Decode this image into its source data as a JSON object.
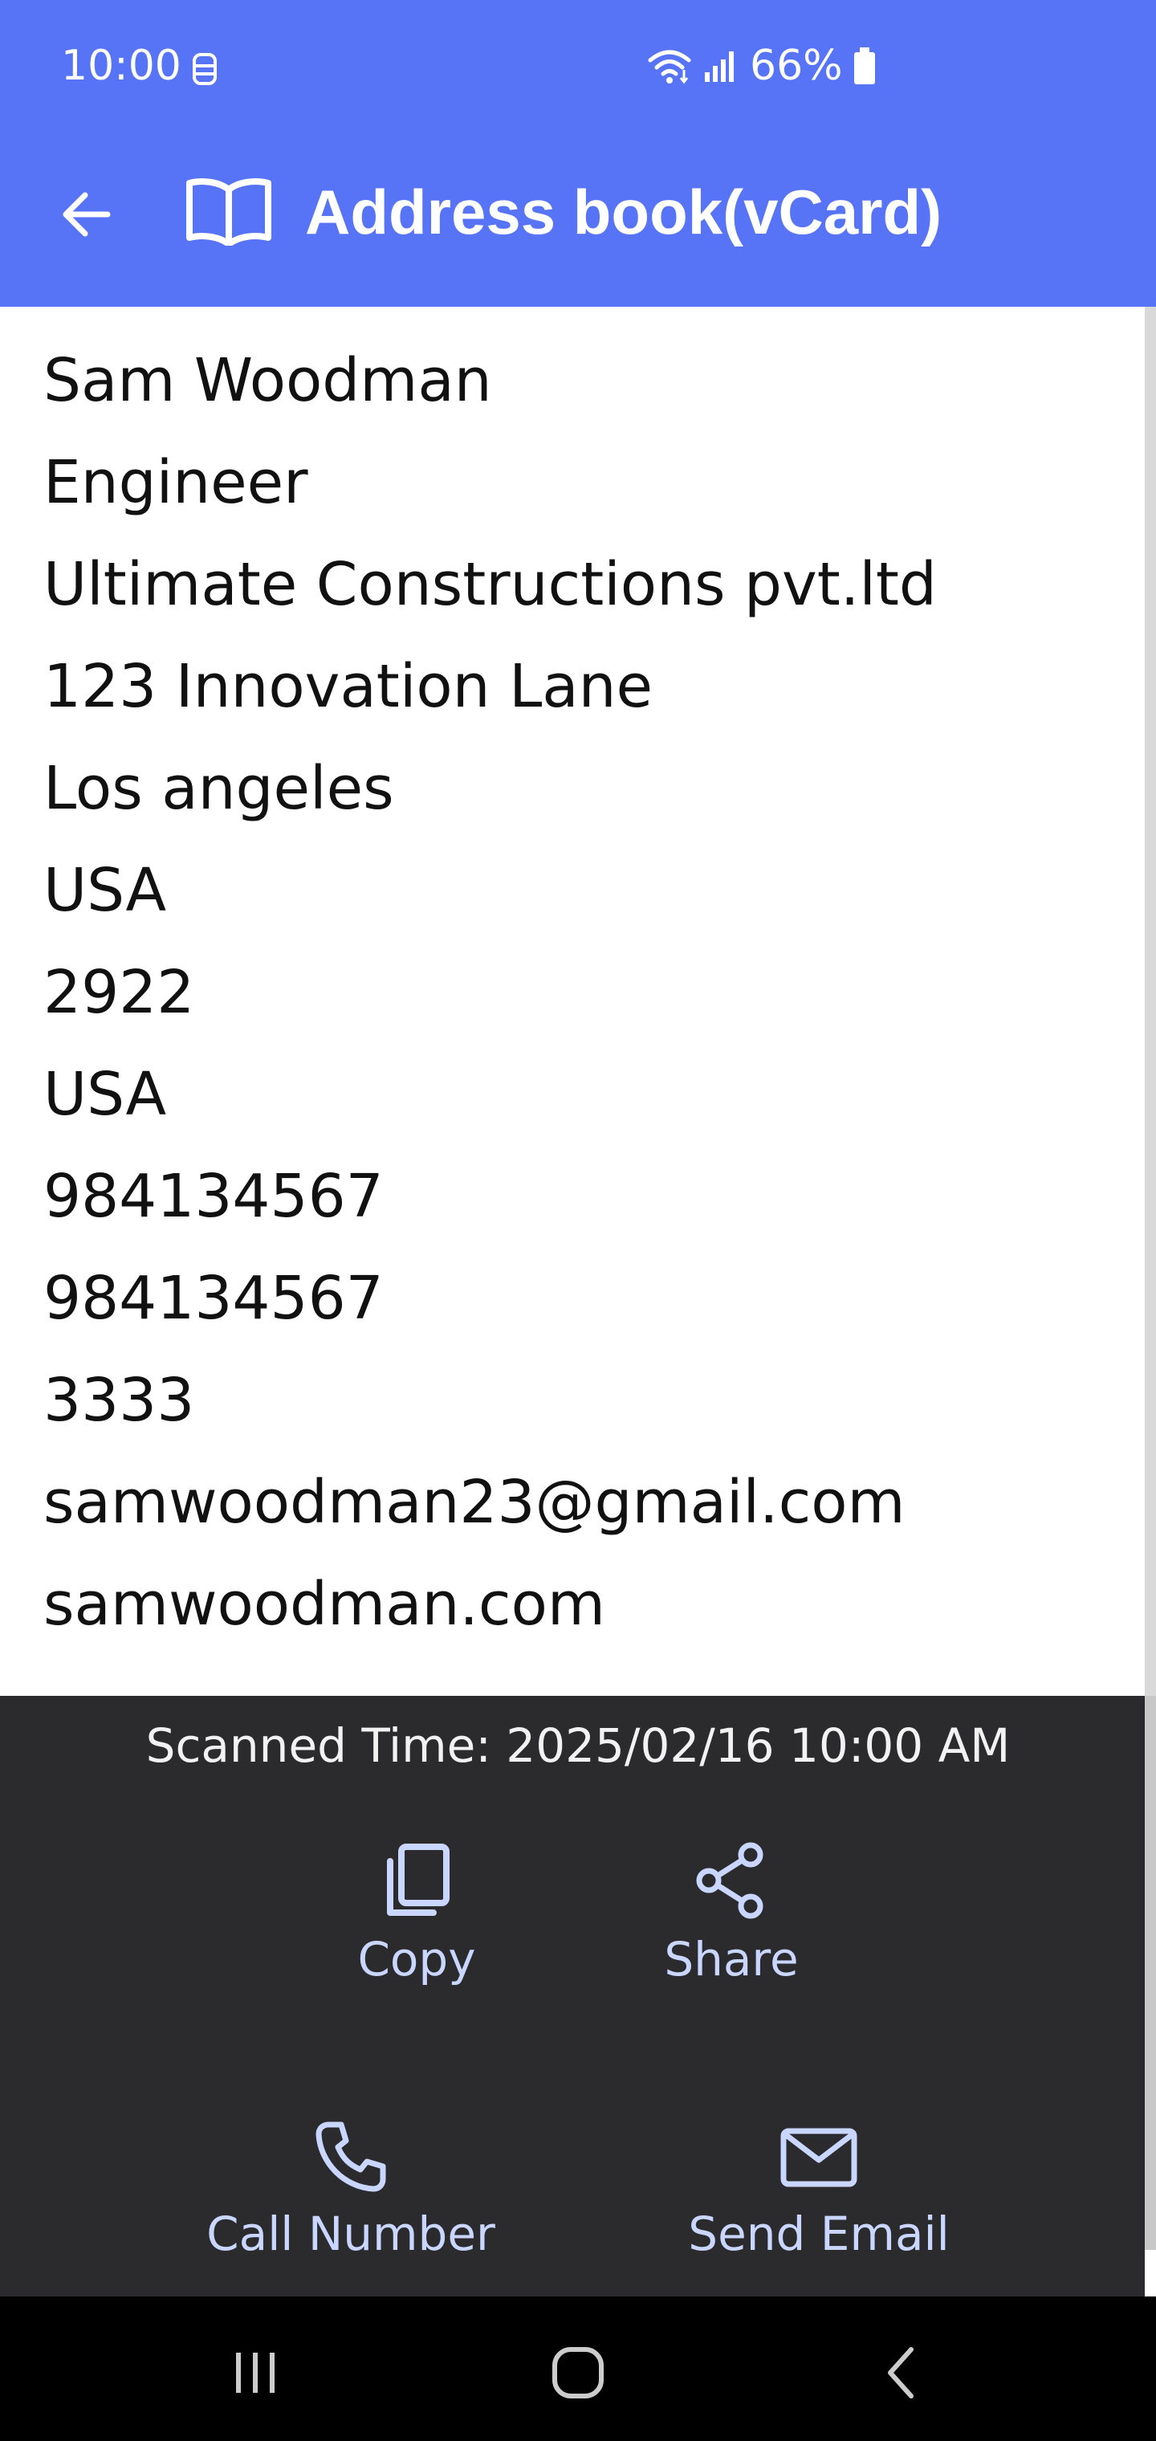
{
  "status_bar": {
    "time": "10:00",
    "battery_pct": "66%"
  },
  "app_bar": {
    "title": "Address book(vCard)",
    "back_icon": "arrow-left-icon",
    "book_icon": "book-open-icon"
  },
  "contact_lines": [
    "Sam Woodman",
    "Engineer",
    "Ultimate Constructions pvt.ltd",
    "123 Innovation Lane",
    "Los angeles",
    "USA",
    "2922",
    "USA",
    "984134567",
    "984134567",
    "3333",
    "samwoodman23@gmail.com",
    "samwoodman.com"
  ],
  "panel": {
    "scanned_time": "Scanned Time: 2025/02/16 10:00 AM",
    "actions": {
      "copy": "Copy",
      "share": "Share",
      "call": "Call Number",
      "email": "Send Email"
    }
  },
  "colors": {
    "header": "#5874f6",
    "panel": "#2b2b2d",
    "action": "#c9d6ff"
  }
}
